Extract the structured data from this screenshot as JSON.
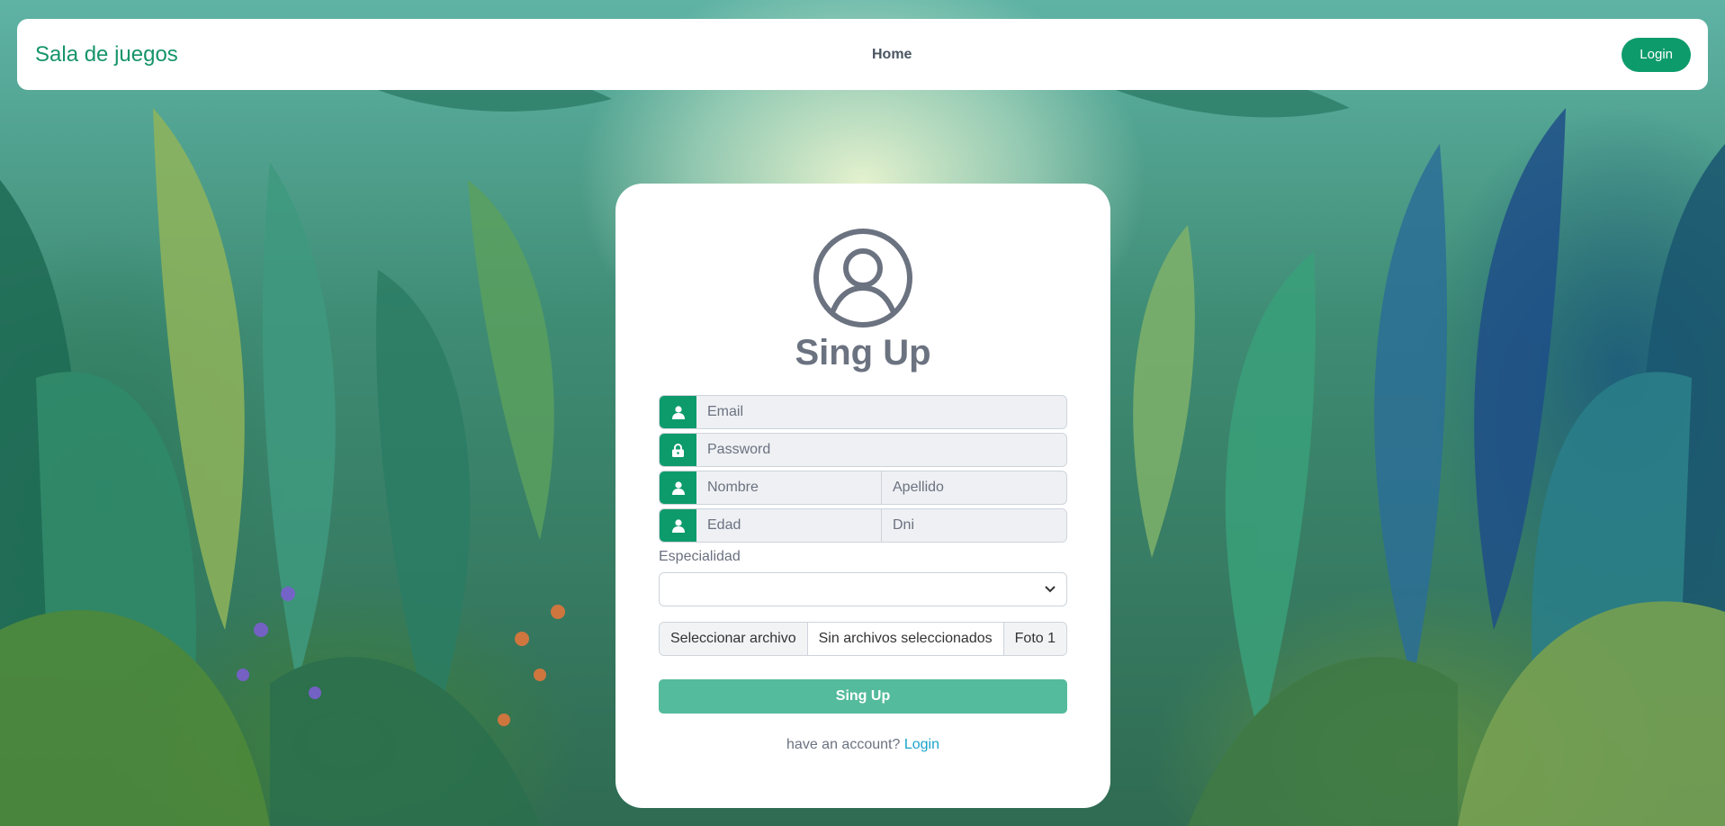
{
  "navbar": {
    "brand": "Sala de juegos",
    "home": "Home",
    "login": "Login"
  },
  "card": {
    "avatar_icon": "user-circle-icon",
    "title": "Sing Up",
    "email_placeholder": "Email",
    "password_placeholder": "Password",
    "nombre_placeholder": "Nombre",
    "apellido_placeholder": "Apellido",
    "edad_placeholder": "Edad",
    "dni_placeholder": "Dni",
    "especialidad_label": "Especialidad",
    "especialidad_value": "",
    "file_button": "Seleccionar archivo",
    "file_status": "Sin archivos seleccionados",
    "file_suffix": "Foto 1",
    "submit": "Sing Up",
    "footer_text": "have an account?",
    "footer_link": "Login"
  },
  "colors": {
    "accent": "#0e9b6b",
    "submit": "#54bb9c",
    "link": "#1aa3c9"
  }
}
